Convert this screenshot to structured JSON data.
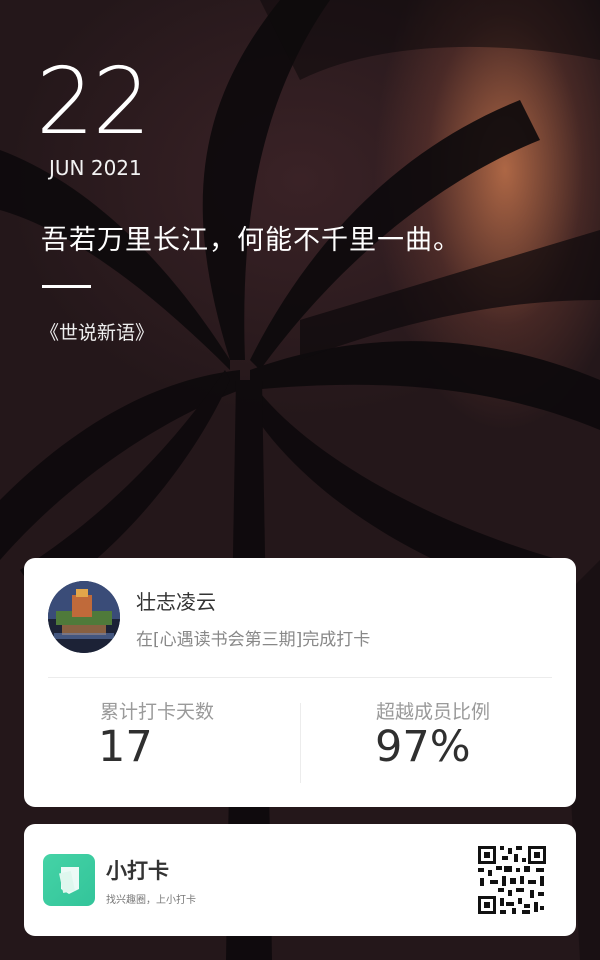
{
  "date": {
    "day": "22",
    "month_year": "JUN 2021"
  },
  "quote": {
    "text": "吾若万里长江，何能不千里一曲。",
    "source": "《世说新语》"
  },
  "user": {
    "name": "壮志凌云",
    "activity": "在[心遇读书会第三期]完成打卡"
  },
  "stats": {
    "days_label": "累计打卡天数",
    "days_value": "17",
    "exceed_label": "超越成员比例",
    "exceed_value": "97%"
  },
  "brand": {
    "name": "小打卡",
    "slogan": "找兴趣圈，上小打卡"
  },
  "colors": {
    "brand_green": "#3dccA0",
    "card_bg": "#ffffff",
    "text_dark": "#333333",
    "text_gray": "#888888"
  },
  "icons": {
    "logo": "card-icon",
    "qr": "qr-code-icon"
  }
}
